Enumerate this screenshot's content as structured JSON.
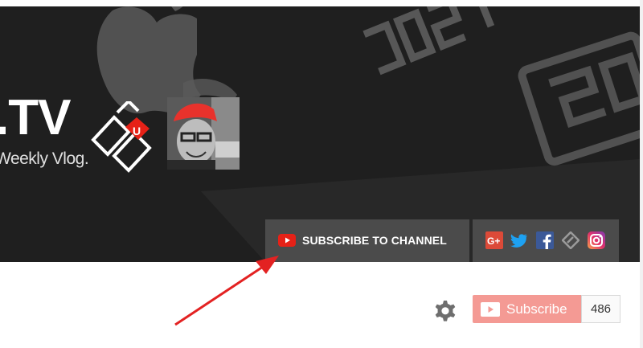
{
  "banner": {
    "brand_text": ".TV",
    "tagline": "Weekly Vlog.",
    "subscribe_channel_label": "SUBSCRIBE TO CHANNEL",
    "social_icons": [
      "google-plus-icon",
      "twitter-icon",
      "facebook-icon",
      "tag-link-icon",
      "instagram-icon"
    ]
  },
  "channel": {
    "subscribe_label": "Subscribe",
    "subscriber_count": "486"
  },
  "colors": {
    "banner_bg": "#1f1f1f",
    "youtube_red": "#e62117",
    "subscribe_disabled": "#f49a94",
    "arrow_red": "#e32222"
  }
}
